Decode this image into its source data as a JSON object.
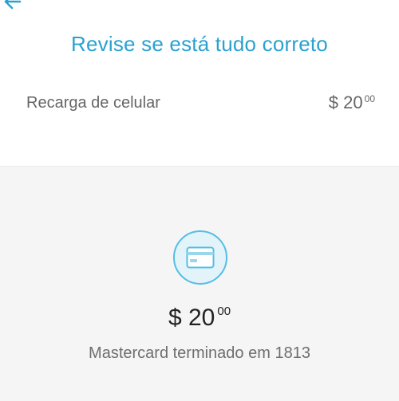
{
  "header": {
    "back_icon": "arrow-left-icon",
    "title": "Revise se está tudo correto",
    "accent_color": "#2aa1d1"
  },
  "summary": {
    "item_label": "Recarga de celular",
    "currency": "$",
    "amount_whole": "20",
    "amount_cents": "00"
  },
  "payment": {
    "icon": "credit-card-icon",
    "currency": "$",
    "total_whole": "20",
    "total_cents": "00",
    "card_text": "Mastercard terminado em 1813"
  }
}
